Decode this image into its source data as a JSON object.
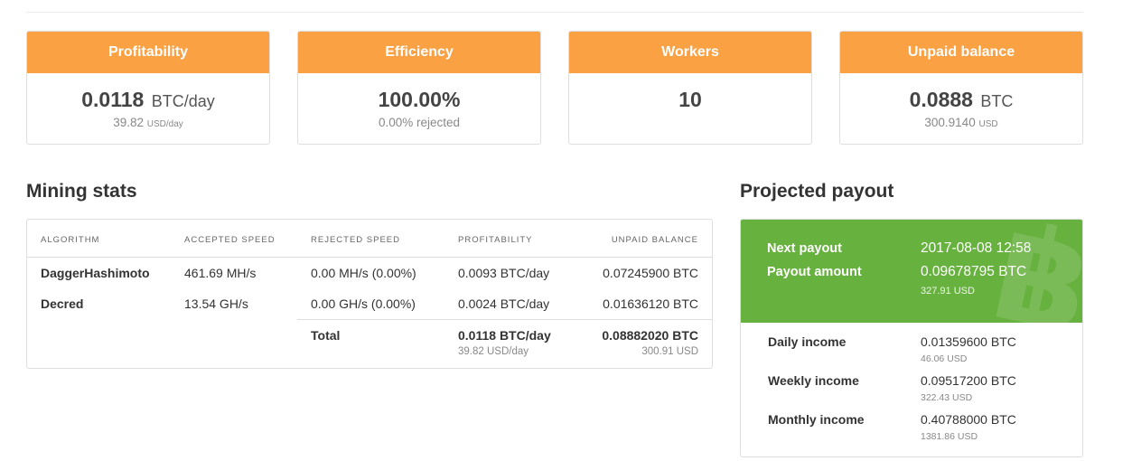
{
  "stat_cards": [
    {
      "title": "Profitability",
      "value": "0.0118",
      "unit": "BTC/day",
      "sub_value": "39.82",
      "sub_unit": "USD/day"
    },
    {
      "title": "Efficiency",
      "value": "100.00%",
      "unit": "",
      "sub_value": "0.00% rejected",
      "sub_unit": ""
    },
    {
      "title": "Workers",
      "value": "10",
      "unit": "",
      "sub_value": "",
      "sub_unit": ""
    },
    {
      "title": "Unpaid balance",
      "value": "0.0888",
      "unit": "BTC",
      "sub_value": "300.9140",
      "sub_unit": "USD"
    }
  ],
  "mining_stats": {
    "title": "Mining stats",
    "columns": [
      "ALGORITHM",
      "ACCEPTED SPEED",
      "REJECTED SPEED",
      "PROFITABILITY",
      "UNPAID BALANCE"
    ],
    "rows": [
      {
        "algorithm": "DaggerHashimoto",
        "accepted": "461.69 MH/s",
        "rejected": "0.00 MH/s (0.00%)",
        "profitability": "0.0093 BTC/day",
        "unpaid": "0.07245900 BTC"
      },
      {
        "algorithm": "Decred",
        "accepted": "13.54 GH/s",
        "rejected": "0.00 GH/s (0.00%)",
        "profitability": "0.0024 BTC/day",
        "unpaid": "0.01636120 BTC"
      }
    ],
    "total": {
      "label": "Total",
      "profitability": "0.0118 BTC/day",
      "profitability_usd": "39.82 USD/day",
      "unpaid": "0.08882020 BTC",
      "unpaid_usd": "300.91 USD"
    }
  },
  "projected_payout": {
    "title": "Projected payout",
    "next_payout_label": "Next payout",
    "next_payout_value": "2017-08-08 12:58",
    "payout_amount_label": "Payout amount",
    "payout_amount_value": "0.09678795 BTC",
    "payout_amount_usd": "327.91 USD",
    "watermark_icon": "bitcoin-icon",
    "colors": {
      "accent_orange": "#f9a143",
      "accent_green": "#67b13f"
    },
    "incomes": [
      {
        "label": "Daily income",
        "value": "0.01359600 BTC",
        "usd": "46.06 USD"
      },
      {
        "label": "Weekly income",
        "value": "0.09517200 BTC",
        "usd": "322.43 USD"
      },
      {
        "label": "Monthly income",
        "value": "0.40788000 BTC",
        "usd": "1381.86 USD"
      }
    ]
  }
}
